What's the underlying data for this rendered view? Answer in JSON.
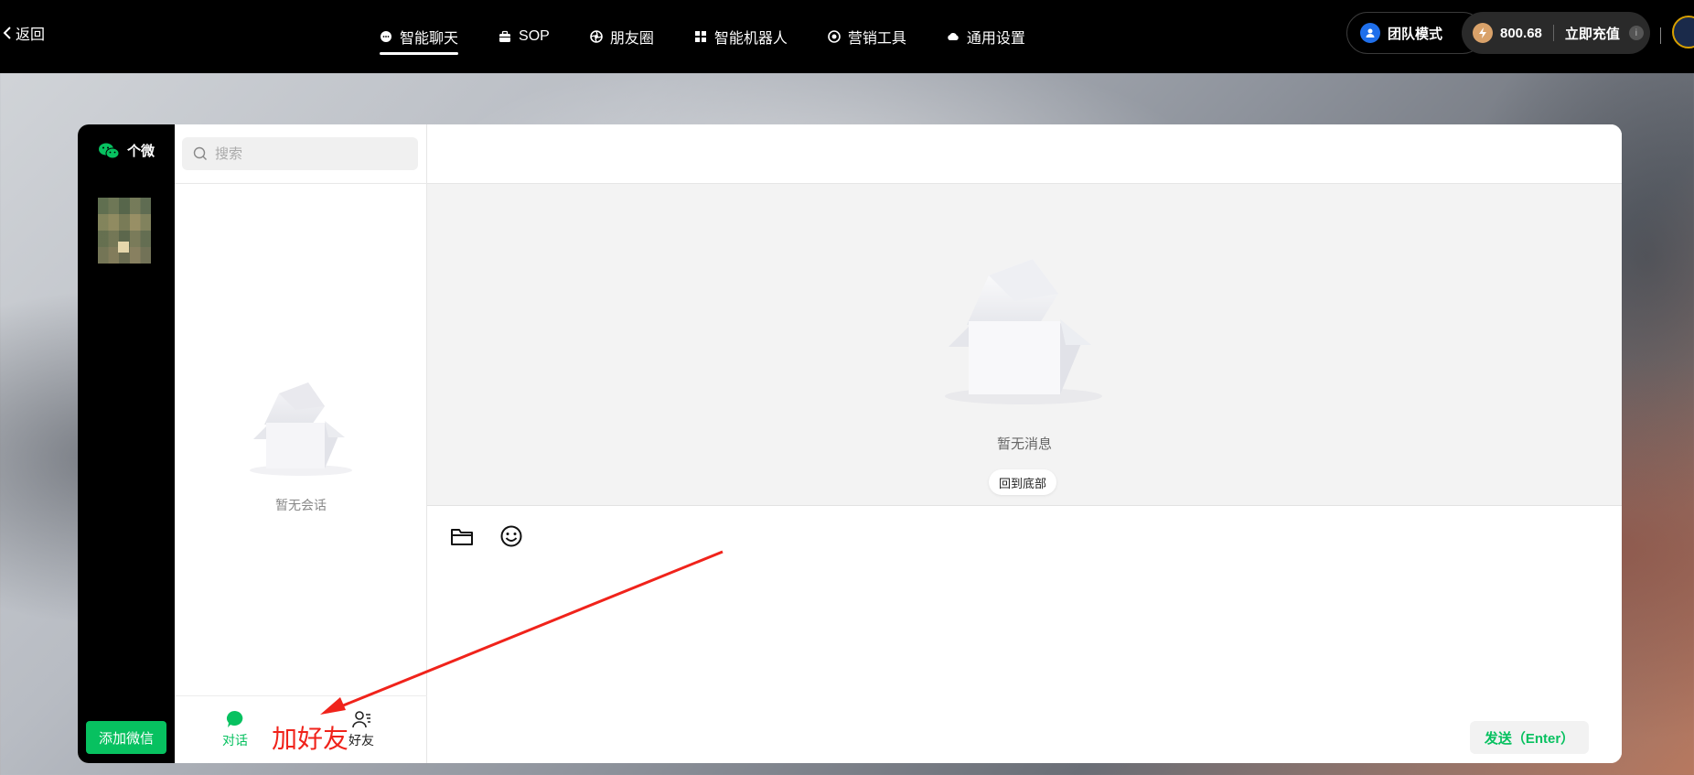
{
  "topbar": {
    "back_label": "返回",
    "nav": [
      {
        "label": "智能聊天",
        "icon": "chat-bubble-icon",
        "active": true
      },
      {
        "label": "SOP",
        "icon": "briefcase-icon",
        "active": false
      },
      {
        "label": "朋友圈",
        "icon": "aperture-icon",
        "active": false
      },
      {
        "label": "智能机器人",
        "icon": "grid-icon",
        "active": false
      },
      {
        "label": "营销工具",
        "icon": "target-icon",
        "active": false
      },
      {
        "label": "通用设置",
        "icon": "cloud-icon",
        "active": false
      }
    ],
    "team_mode_label": "团队模式",
    "balance_amount": "800.68",
    "recharge_label": "立即充值",
    "info_glyph": "i"
  },
  "sidebar": {
    "account_type": "个微",
    "add_wechat_label": "添加微信"
  },
  "conversations": {
    "search_placeholder": "搜索",
    "empty_text": "暂无会话",
    "tabs": [
      {
        "label": "对话",
        "active": true
      },
      {
        "label": "好友",
        "active": false
      }
    ]
  },
  "chat": {
    "empty_text": "暂无消息",
    "to_bottom_label": "回到底部",
    "send_label": "发送（Enter）"
  },
  "annotation": {
    "text": "加好友",
    "color": "#f0231b"
  },
  "colors": {
    "accent_green": "#07c160",
    "topbar_bg": "#000000"
  }
}
